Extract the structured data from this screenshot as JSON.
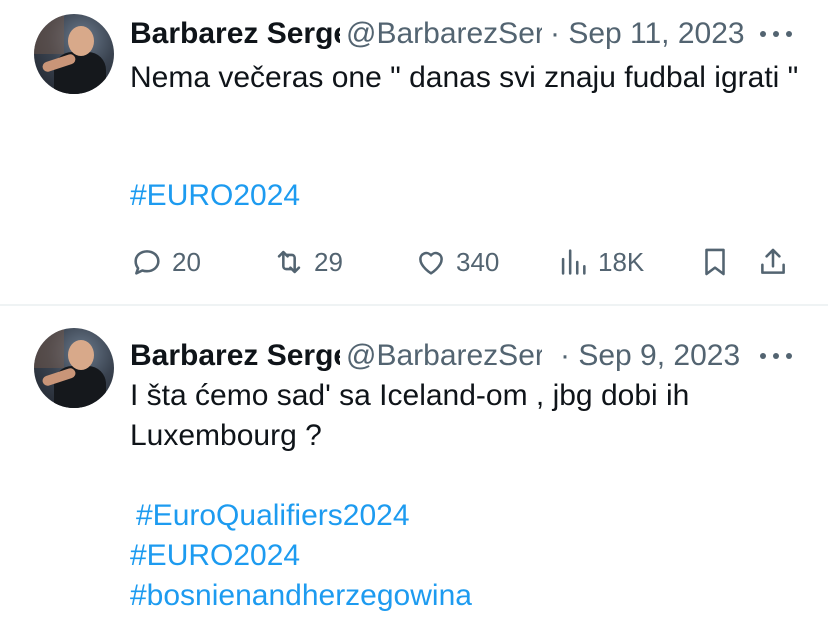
{
  "tweets": [
    {
      "author_name": "Barbarez Serge",
      "handle": "@BarbarezSerg",
      "date": "Sep 11, 2023",
      "text": "Nema večeras one \" danas svi znaju fudbal igrati \"",
      "hashtags": [
        "#EURO2024"
      ],
      "replies": "20",
      "retweets": "29",
      "likes": "340",
      "views": "18K"
    },
    {
      "author_name": "Barbarez Serge",
      "handle": "@BarbarezSerg",
      "date": "Sep 9, 2023",
      "text": "I šta ćemo sad' sa Iceland-om , jbg dobi ih Luxembourg  ?",
      "hashtags": [
        "#EuroQualifiers2024",
        "#EURO2024",
        "#bosnienandherzegowina"
      ]
    }
  ],
  "icons": {
    "reply": "speech-bubble",
    "retweet": "retweet-arrows",
    "like": "heart",
    "views": "bar-chart",
    "bookmark": "bookmark",
    "share": "share-upload",
    "more": "ellipsis"
  },
  "colors": {
    "text": "#0f1419",
    "secondary": "#536471",
    "link": "#1d9bf0",
    "divider": "#eff3f4"
  }
}
